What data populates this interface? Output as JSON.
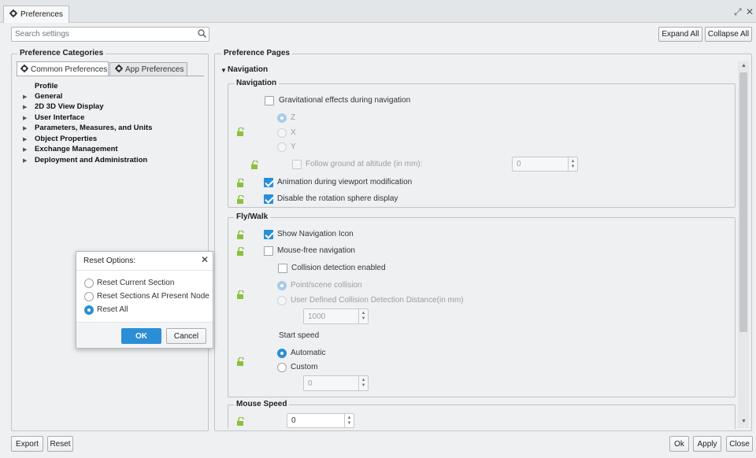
{
  "window": {
    "tab_label": "Preferences",
    "restore_glyph": "⤢",
    "close_glyph": "✕"
  },
  "search": {
    "placeholder": "Search settings"
  },
  "top_buttons": {
    "expand_all": "Expand All",
    "collapse_all": "Collapse All"
  },
  "left_panel": {
    "title": "Preference Categories",
    "tabs": [
      {
        "label": "Common Preferences",
        "active": true
      },
      {
        "label": "App Preferences",
        "active": false
      }
    ],
    "tree": [
      {
        "label": "Profile",
        "expandable": false
      },
      {
        "label": "General",
        "expandable": true
      },
      {
        "label": "2D 3D View Display",
        "expandable": true
      },
      {
        "label": "User Interface",
        "expandable": true
      },
      {
        "label": "Parameters, Measures, and Units",
        "expandable": true
      },
      {
        "label": "Object Properties",
        "expandable": true
      },
      {
        "label": "Exchange Management",
        "expandable": true
      },
      {
        "label": "Deployment and Administration",
        "expandable": true
      }
    ]
  },
  "right_panel": {
    "title": "Preference Pages",
    "section_title": "Navigation",
    "navigation_group": {
      "title": "Navigation",
      "gravitational": "Gravitational effects during navigation",
      "axis_options": [
        "Z",
        "X",
        "Y"
      ],
      "follow_ground": "Follow ground at altitude (in mm):",
      "follow_ground_value": "0",
      "animation": "Animation during viewport modification",
      "disable_sphere": "Disable the rotation sphere display"
    },
    "flywalk_group": {
      "title": "Fly/Walk",
      "show_nav_icon": "Show Navigation Icon",
      "mouse_free": "Mouse-free navigation",
      "collision_enabled": "Collision detection enabled",
      "point_scene": "Point/scene collision",
      "user_defined": "User Defined Collision Detection Distance(in mm)",
      "distance_value": "1000",
      "start_speed": "Start speed",
      "automatic": "Automatic",
      "custom": "Custom",
      "custom_value": "0"
    },
    "mouse_speed_group": {
      "title": "Mouse Speed",
      "value": "0"
    }
  },
  "reset_dialog": {
    "title": "Reset Options:",
    "options": [
      {
        "label": "Reset Current Section",
        "selected": false
      },
      {
        "label": "Reset Sections At Present Node",
        "selected": false
      },
      {
        "label": "Reset All",
        "selected": true
      }
    ],
    "ok": "OK",
    "cancel": "Cancel"
  },
  "footer": {
    "export": "Export",
    "reset": "Reset",
    "ok": "Ok",
    "apply": "Apply",
    "close": "Close"
  },
  "colors": {
    "accent": "#2b8fd6",
    "lock_icon": "#8fbf3a"
  }
}
